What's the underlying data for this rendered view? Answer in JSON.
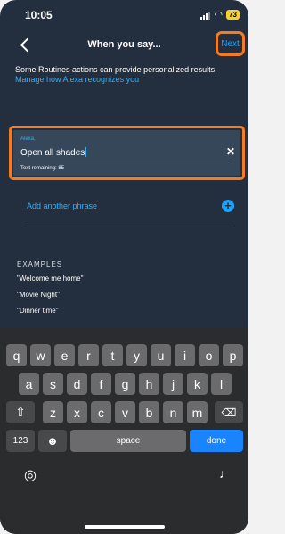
{
  "status": {
    "time": "10:05",
    "battery": "73"
  },
  "nav": {
    "title": "When you say...",
    "next_label": "Next"
  },
  "info": {
    "text": "Some Routines actions can provide personalized results.",
    "link": "Manage how Alexa recognizes you"
  },
  "input": {
    "label": "Alexa,",
    "value": "Open all shades",
    "remaining": "Text remaining: 85"
  },
  "add_phrase": {
    "label": "Add another phrase"
  },
  "examples": {
    "heading": "EXAMPLES",
    "items": [
      "\"Welcome me home\"",
      "\"Movie Night\"",
      "\"Dinner time\""
    ]
  },
  "keyboard": {
    "row1": [
      "q",
      "w",
      "e",
      "r",
      "t",
      "y",
      "u",
      "i",
      "o",
      "p"
    ],
    "row2": [
      "a",
      "s",
      "d",
      "f",
      "g",
      "h",
      "j",
      "k",
      "l"
    ],
    "row3": [
      "z",
      "x",
      "c",
      "v",
      "b",
      "n",
      "m"
    ],
    "numbers_label": "123",
    "space_label": "space",
    "done_label": "done"
  },
  "colors": {
    "accent": "#2bb1ff",
    "highlight": "#f47b20",
    "background": "#232f3e"
  }
}
